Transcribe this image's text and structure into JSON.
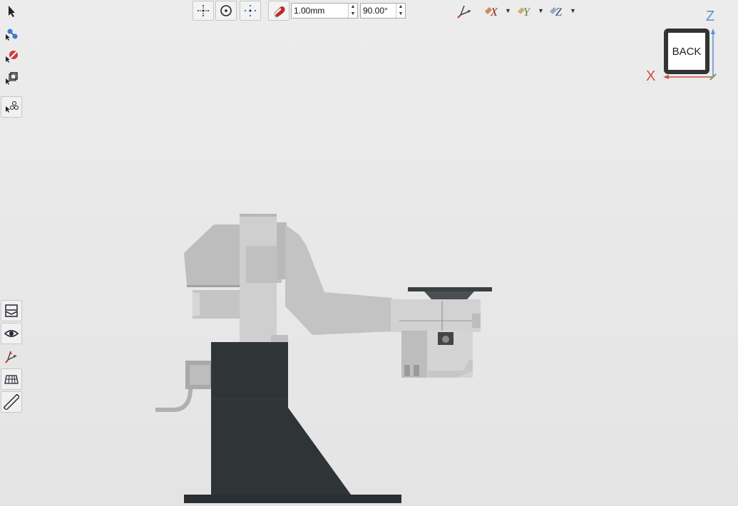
{
  "toolbar": {
    "snap_distance": "1.00mm",
    "snap_angle": "90.00°"
  },
  "view_cube": {
    "face_label": "BACK",
    "axis_x": "X",
    "axis_z": "Z"
  },
  "colors": {
    "axis_x": "#d0503a",
    "axis_z": "#5b8fd6",
    "axis_y": "#7a9a6a",
    "robot_light": "#c8c8c8",
    "base_dark": "#2f3437",
    "magnet": "#c0272d"
  },
  "icons": {
    "left_tools": [
      "select-arrow-icon",
      "select-points-icon",
      "select-none-icon",
      "select-box-icon",
      "select-assembly-icon"
    ],
    "left_tools_lower": [
      "section-view-icon",
      "visibility-eye-icon",
      "axes-triad-icon",
      "grid-icon",
      "measure-ruler-icon"
    ],
    "top_tools": [
      "translate-icon",
      "rotate-icon",
      "snap-points-icon",
      "magnet-icon",
      "triad-icon",
      "x-axis-icon",
      "y-axis-icon",
      "z-axis-icon"
    ]
  }
}
